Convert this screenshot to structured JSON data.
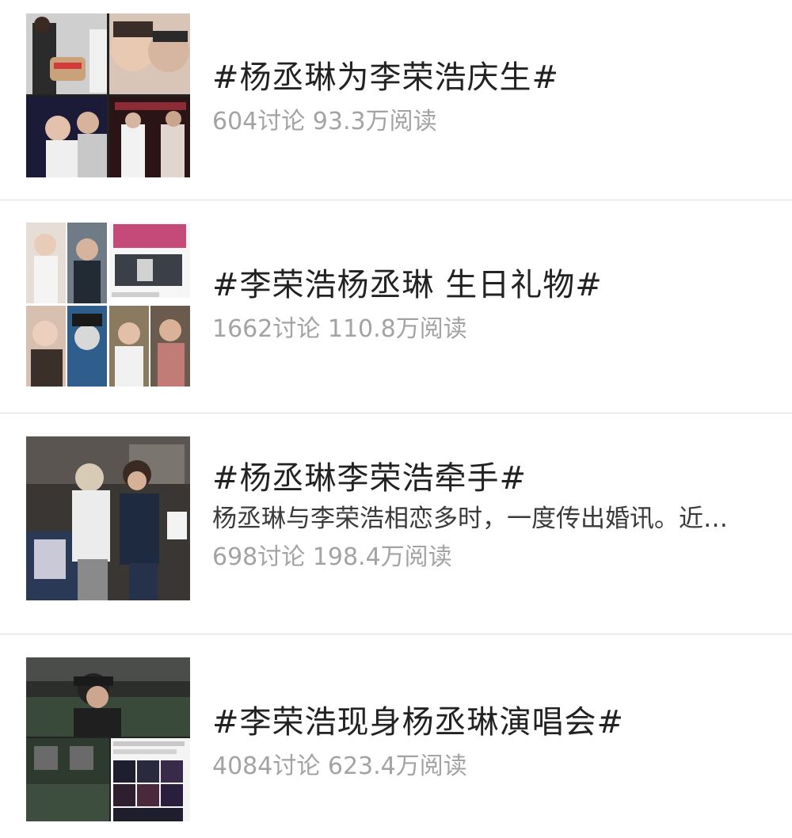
{
  "topics": [
    {
      "title": "#杨丞琳为李荣浩庆生#",
      "stats": "604讨论 93.3万阅读",
      "thumb_icon": "photo-collage-icon"
    },
    {
      "title": "#李荣浩杨丞琳 生日礼物#",
      "stats": "1662讨论 110.8万阅读",
      "thumb_icon": "photo-collage-icon"
    },
    {
      "title": "#杨丞琳李荣浩牵手#",
      "description": "杨丞琳与李荣浩相恋多时，一度传出婚讯。近…",
      "stats": "698讨论 198.4万阅读",
      "thumb_icon": "photo-icon"
    },
    {
      "title": "#李荣浩现身杨丞琳演唱会#",
      "stats": "4084讨论 623.4万阅读",
      "thumb_icon": "photo-collage-icon"
    }
  ],
  "colors": {
    "title": "#222222",
    "stats": "#a3a3a3",
    "description": "#3a3a3a",
    "divider": "#dcdcdc",
    "background": "#ffffff"
  }
}
